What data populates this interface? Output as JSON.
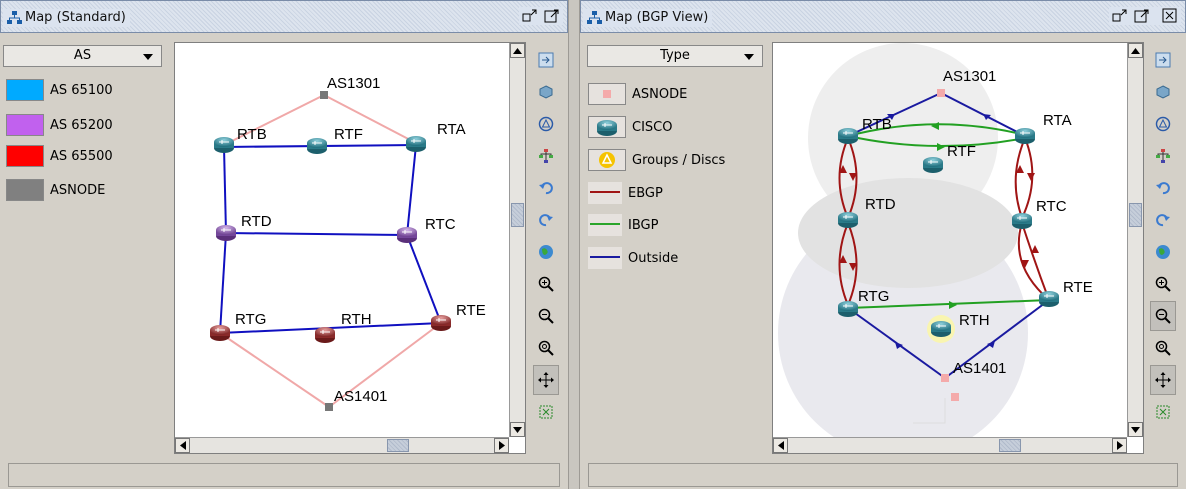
{
  "left_panel": {
    "title": "Map (Standard)",
    "legend_header": "AS",
    "legend_items": [
      {
        "label": "AS 65100",
        "color": "#00aaff"
      },
      {
        "label": "AS 65200",
        "color": "#c161ee"
      },
      {
        "label": "AS 65500",
        "color": "#ff0000"
      },
      {
        "label": "ASNODE",
        "color": "#808080"
      }
    ],
    "nodes": {
      "as1301": "AS1301",
      "rtb": "RTB",
      "rtf": "RTF",
      "rta": "RTA",
      "rtd": "RTD",
      "rtc": "RTC",
      "rtg": "RTG",
      "rth": "RTH",
      "rte": "RTE",
      "as1401": "AS1401"
    },
    "status_text": ""
  },
  "right_panel": {
    "title": "Map (BGP View)",
    "legend_header": "Type",
    "legend_items": [
      {
        "label": "ASNODE",
        "icon": "asnode-icon",
        "color": "#f4aaaa"
      },
      {
        "label": "CISCO",
        "icon": "router-icon",
        "color": "#2d7f8e"
      },
      {
        "label": "Groups / Discs",
        "icon": "group-icon",
        "color": "#f5c300"
      },
      {
        "label": "EBGP",
        "icon": "ebgp-line-icon",
        "color": "#a01515"
      },
      {
        "label": "IBGP",
        "icon": "ibgp-line-icon",
        "color": "#2aa52a"
      },
      {
        "label": "Outside",
        "icon": "outside-line-icon",
        "color": "#1a1aa0"
      }
    ],
    "nodes": {
      "as1301": "AS1301",
      "rtb": "RTB",
      "rtf": "RTF",
      "rta": "RTA",
      "rtd": "RTD",
      "rtc": "RTC",
      "rtg": "RTG",
      "rth": "RTH",
      "rte": "RTE",
      "as1401": "AS1401"
    },
    "status_text": ""
  },
  "toolbar_icons": [
    "fit-icon",
    "cube-icon",
    "layout-icon",
    "tree-layout-icon",
    "undo-icon",
    "redo-icon",
    "globe-icon",
    "zoom-in-icon",
    "zoom-out-icon",
    "zoom-fit-icon",
    "pan-icon",
    "select-icon"
  ],
  "colors": {
    "window_bg": "#d4d0c8",
    "link_blue": "#1010c0",
    "link_pink": "#f0a8a8",
    "ebgp": "#a01515",
    "ibgp": "#22a022",
    "outside": "#1a1aa0"
  }
}
